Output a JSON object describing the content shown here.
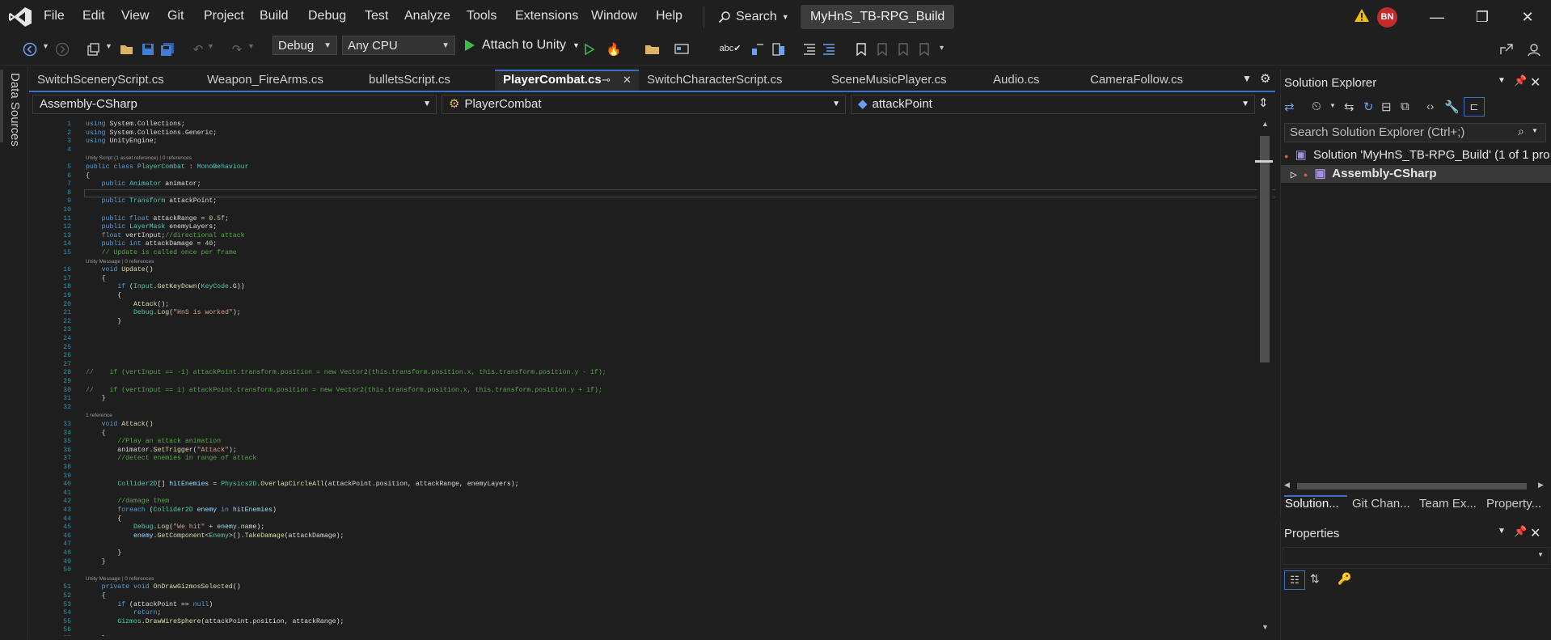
{
  "menubar": {
    "items": [
      "File",
      "Edit",
      "View",
      "Git",
      "Project",
      "Build",
      "Debug",
      "Test",
      "Analyze",
      "Tools",
      "Extensions",
      "Window",
      "Help"
    ],
    "search_label": "Search",
    "solution_title": "MyHnS_TB-RPG_Build",
    "avatar_initials": "BN"
  },
  "toolbar": {
    "configuration": "Debug",
    "platform": "Any CPU",
    "attach_label": "Attach to Unity"
  },
  "left_rail": {
    "label": "Data Sources"
  },
  "tabs": [
    {
      "label": "SwitchSceneryScript.cs",
      "active": false
    },
    {
      "label": "Weapon_FireArms.cs",
      "active": false
    },
    {
      "label": "bulletsScript.cs",
      "active": false
    },
    {
      "label": "PlayerCombat.cs",
      "active": true
    },
    {
      "label": "SwitchCharacterScript.cs",
      "active": false
    },
    {
      "label": "SceneMusicPlayer.cs",
      "active": false
    },
    {
      "label": "Audio.cs",
      "active": false
    },
    {
      "label": "CameraFollow.cs",
      "active": false
    }
  ],
  "navbar": {
    "project": "Assembly-CSharp",
    "type": "PlayerCombat",
    "member": "attackPoint"
  },
  "code_lines": [
    {
      "n": "1",
      "html": "<span class='kw'>using</span> System.Collections;"
    },
    {
      "n": "2",
      "html": "<span class='kw'>using</span> System.Collections.Generic;"
    },
    {
      "n": "3",
      "html": "<span class='kw'>using</span> UnityEngine;"
    },
    {
      "n": "4",
      "html": ""
    },
    {
      "lens": "Unity Script (1 asset reference) | 0 references"
    },
    {
      "n": "5",
      "html": "<span class='kw'>public class</span> <span class='ty'>PlayerCombat</span> : <span class='ty'>MonoBehaviour</span>"
    },
    {
      "n": "6",
      "html": "{"
    },
    {
      "n": "7",
      "html": "    <span class='kw'>public</span> <span class='ty'>Animator</span> animator;"
    },
    {
      "n": "8",
      "html": "",
      "current": true
    },
    {
      "n": "9",
      "html": "    <span class='kw'>public</span> <span class='ty'>Transform</span> attackPoint;"
    },
    {
      "n": "10",
      "html": ""
    },
    {
      "n": "11",
      "html": "    <span class='kw'>public float</span> attackRange = <span class='nm'>0.5f</span>;"
    },
    {
      "n": "12",
      "html": "    <span class='kw'>public</span> <span class='ty'>LayerMask</span> enemyLayers;"
    },
    {
      "n": "13",
      "html": "    <span class='kw'>float</span> vertInput;<span class='cm'>//directional attack</span>"
    },
    {
      "n": "14",
      "html": "    <span class='kw'>public int</span> attackDamage = <span class='nm'>40</span>;"
    },
    {
      "n": "15",
      "html": "    <span class='cm'>// Update is called once per frame</span>"
    },
    {
      "lens": "    Unity Message | 0 references"
    },
    {
      "n": "16",
      "html": "    <span class='kw'>void</span> <span class='fn'>Update</span>()"
    },
    {
      "n": "17",
      "html": "    {"
    },
    {
      "n": "18",
      "html": "        <span class='kw'>if</span> (<span class='ty'>Input</span>.<span class='fn'>GetKeyDown</span>(<span class='ty'>KeyCode</span>.G))"
    },
    {
      "n": "19",
      "html": "        {"
    },
    {
      "n": "20",
      "html": "            <span class='fn'>Attack</span>();"
    },
    {
      "n": "21",
      "html": "            <span class='ty'>Debug</span>.<span class='fn'>Log</span>(<span class='st'>\"HnS is worked\"</span>);"
    },
    {
      "n": "22",
      "html": "        }"
    },
    {
      "n": "23",
      "html": ""
    },
    {
      "n": "24",
      "html": ""
    },
    {
      "n": "25",
      "html": ""
    },
    {
      "n": "26",
      "html": ""
    },
    {
      "n": "27",
      "html": ""
    },
    {
      "n": "28",
      "html": "<span class='cm'>//    if (vertInput == -1) attackPoint.transform.position = new Vector2(this.transform.position.x, this.transform.position.y - 1f);</span>"
    },
    {
      "n": "29",
      "html": ""
    },
    {
      "n": "30",
      "html": "<span class='cm'>//    if (vertInput == 1) attackPoint.transform.position = new Vector2(this.transform.position.x, this.transform.position.y + 1f);</span>"
    },
    {
      "n": "31",
      "html": "    }"
    },
    {
      "n": "32",
      "html": ""
    },
    {
      "lens": "    1 reference"
    },
    {
      "n": "33",
      "html": "    <span class='kw'>void</span> <span class='fn'>Attack</span>()"
    },
    {
      "n": "34",
      "html": "    {"
    },
    {
      "n": "35",
      "html": "        <span class='cm'>//Play an attack animation</span>"
    },
    {
      "n": "36",
      "html": "        animator.<span class='fn'>SetTrigger</span>(<span class='st'>\"Attack\"</span>);"
    },
    {
      "n": "37",
      "html": "        <span class='cm'>//detect enemies in range of attack</span>"
    },
    {
      "n": "38",
      "html": ""
    },
    {
      "n": "39",
      "html": ""
    },
    {
      "n": "40",
      "html": "        <span class='ty'>Collider2D</span>[] <span class='vr'>hitEnemies</span> = <span class='ty'>Physics2D</span>.<span class='fn'>OverlapCircleAll</span>(attackPoint.position, attackRange, enemyLayers);"
    },
    {
      "n": "41",
      "html": ""
    },
    {
      "n": "42",
      "html": "        <span class='cm'>//damage them</span>"
    },
    {
      "n": "43",
      "html": "        <span class='kw'>foreach</span> (<span class='ty'>Collider2D</span> <span class='vr'>enemy</span> <span class='kw'>in</span> <span class='vr'>hitEnemies</span>)"
    },
    {
      "n": "44",
      "html": "        {"
    },
    {
      "n": "45",
      "html": "            <span class='ty'>Debug</span>.<span class='fn'>Log</span>(<span class='st'>\"We hit\"</span> + <span class='vr'>enemy</span>.name);"
    },
    {
      "n": "46",
      "html": "            <span class='vr'>enemy</span>.<span class='fn'>GetComponent</span>&lt;<span class='ty'>Enemy</span>&gt;().<span class='fn'>TakeDamage</span>(attackDamage);"
    },
    {
      "n": "47",
      "html": ""
    },
    {
      "n": "48",
      "html": "        }"
    },
    {
      "n": "49",
      "html": "    }"
    },
    {
      "n": "50",
      "html": ""
    },
    {
      "lens": "    Unity Message | 0 references"
    },
    {
      "n": "51",
      "html": "    <span class='kw'>private void</span> <span class='fn'>OnDrawGizmosSelected</span>()"
    },
    {
      "n": "52",
      "html": "    {"
    },
    {
      "n": "53",
      "html": "        <span class='kw'>if</span> (attackPoint == <span class='kw'>null</span>)"
    },
    {
      "n": "54",
      "html": "            <span class='kw'>return</span>;"
    },
    {
      "n": "55",
      "html": "        <span class='ty'>Gizmos</span>.<span class='fn'>DrawWireSphere</span>(attackPoint.position, attackRange);"
    },
    {
      "n": "56",
      "html": ""
    },
    {
      "n": "57",
      "html": "    }"
    }
  ],
  "solution_explorer": {
    "title": "Solution Explorer",
    "search_placeholder": "Search Solution Explorer (Ctrl+;)",
    "solution_node": "Solution 'MyHnS_TB-RPG_Build' (1 of 1 proj",
    "project_node": "Assembly-CSharp",
    "bottom_tabs": [
      "Solution...",
      "Git Chan...",
      "Team Ex...",
      "Property..."
    ]
  },
  "properties": {
    "title": "Properties"
  }
}
